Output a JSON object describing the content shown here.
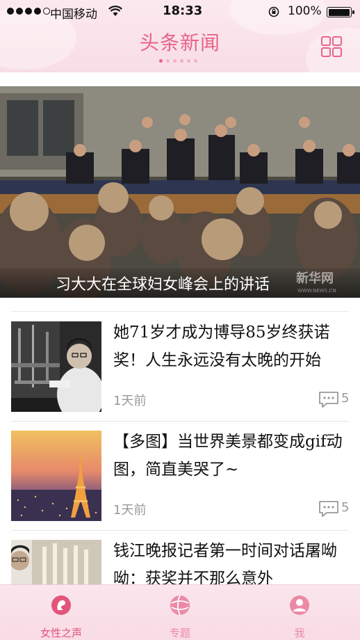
{
  "status_bar": {
    "carrier": "中国移动",
    "time": "18:33",
    "battery": "100%"
  },
  "header": {
    "title": "头条新闻",
    "menu_icon": "grid-icon",
    "pager_count": 6,
    "pager_active": 0
  },
  "banner": {
    "caption": "习大大在全球妇女峰会上的讲话",
    "watermark": "新华网",
    "watermark_sub": "WWW.NEWS.CN"
  },
  "news": [
    {
      "headline": "她71岁才成为博导85岁终获诺奖！人生永远没有太晚的开始",
      "time": "1天前",
      "comments": "5"
    },
    {
      "headline": "【多图】当世界美景都变成gif动图，简直美哭了~",
      "time": "1天前",
      "comments": "5"
    },
    {
      "headline": "钱江晚报记者第一时间对话屠呦呦：获奖并不那么意外",
      "time": "",
      "comments": ""
    }
  ],
  "tabbar": {
    "tabs": [
      {
        "label": "女性之声",
        "icon": "female-voice-icon",
        "active": true
      },
      {
        "label": "专题",
        "icon": "topic-icon",
        "active": false
      },
      {
        "label": "我",
        "icon": "profile-icon",
        "active": false
      }
    ]
  },
  "colors": {
    "accent": "#e86487",
    "header_bg": "#f9e2ea",
    "active_tab": "#e2557b",
    "inactive_tab": "#ec8aa6",
    "meta_text": "#999999"
  }
}
